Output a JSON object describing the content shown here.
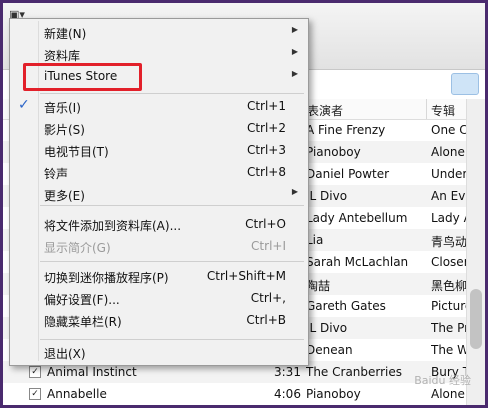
{
  "window": {
    "menu_toggle_icon": "menu-toggle-icon"
  },
  "table": {
    "headers": {
      "artist": "表演者",
      "album": "专辑"
    },
    "rows": [
      {
        "artist": "A Fine Frenzy",
        "album": "One Cell In"
      },
      {
        "artist": "Pianoboy",
        "album": "Alone On"
      },
      {
        "artist": "Daniel Powter",
        "album": "Under The"
      },
      {
        "artist": "IL Divo",
        "album": "An Evenin"
      },
      {
        "artist": "Lady Antebellum",
        "album": "Lady Ante"
      },
      {
        "artist": "Lia",
        "album": "青鸟动漫"
      },
      {
        "artist": "Sarah McLachlan",
        "album": "Closer-the"
      },
      {
        "artist": "陶喆",
        "album": "黑色柳丁"
      },
      {
        "artist": "Gareth Gates",
        "album": "Pictures o"
      },
      {
        "artist": "IL Divo",
        "album": "The Prom"
      },
      {
        "artist": "Denean",
        "album": "The Weav"
      },
      {
        "name": "Animal Instinct",
        "time": "3:31",
        "artist": "The Cranberries",
        "album": "Bury The H"
      },
      {
        "name": "Annabelle",
        "time": "4:06",
        "artist": "Pianoboy",
        "album": "Alone On"
      }
    ]
  },
  "menu": {
    "items": [
      {
        "label": "新建(N)",
        "submenu": true
      },
      {
        "label": "资料库",
        "submenu": true
      },
      {
        "label": "iTunes Store",
        "submenu": true
      },
      {
        "label": "音乐(I)",
        "shortcut": "Ctrl+1",
        "checked": true
      },
      {
        "label": "影片(S)",
        "shortcut": "Ctrl+2"
      },
      {
        "label": "电视节目(T)",
        "shortcut": "Ctrl+3"
      },
      {
        "label": "铃声",
        "shortcut": "Ctrl+8"
      },
      {
        "label": "更多(E)",
        "submenu": true
      },
      {
        "label": "将文件添加到资料库(A)...",
        "shortcut": "Ctrl+O"
      },
      {
        "label": "显示简介(G)",
        "shortcut": "Ctrl+I",
        "disabled": true
      },
      {
        "label": "切换到迷你播放程序(P)",
        "shortcut": "Ctrl+Shift+M"
      },
      {
        "label": "偏好设置(F)...",
        "shortcut": "Ctrl+,"
      },
      {
        "label": "隐藏菜单栏(R)",
        "shortcut": "Ctrl+B"
      },
      {
        "label": "退出(X)"
      }
    ],
    "highlight_color": "#e2202a",
    "check_color": "#2a64c8"
  },
  "watermark": "Baidu 经验"
}
